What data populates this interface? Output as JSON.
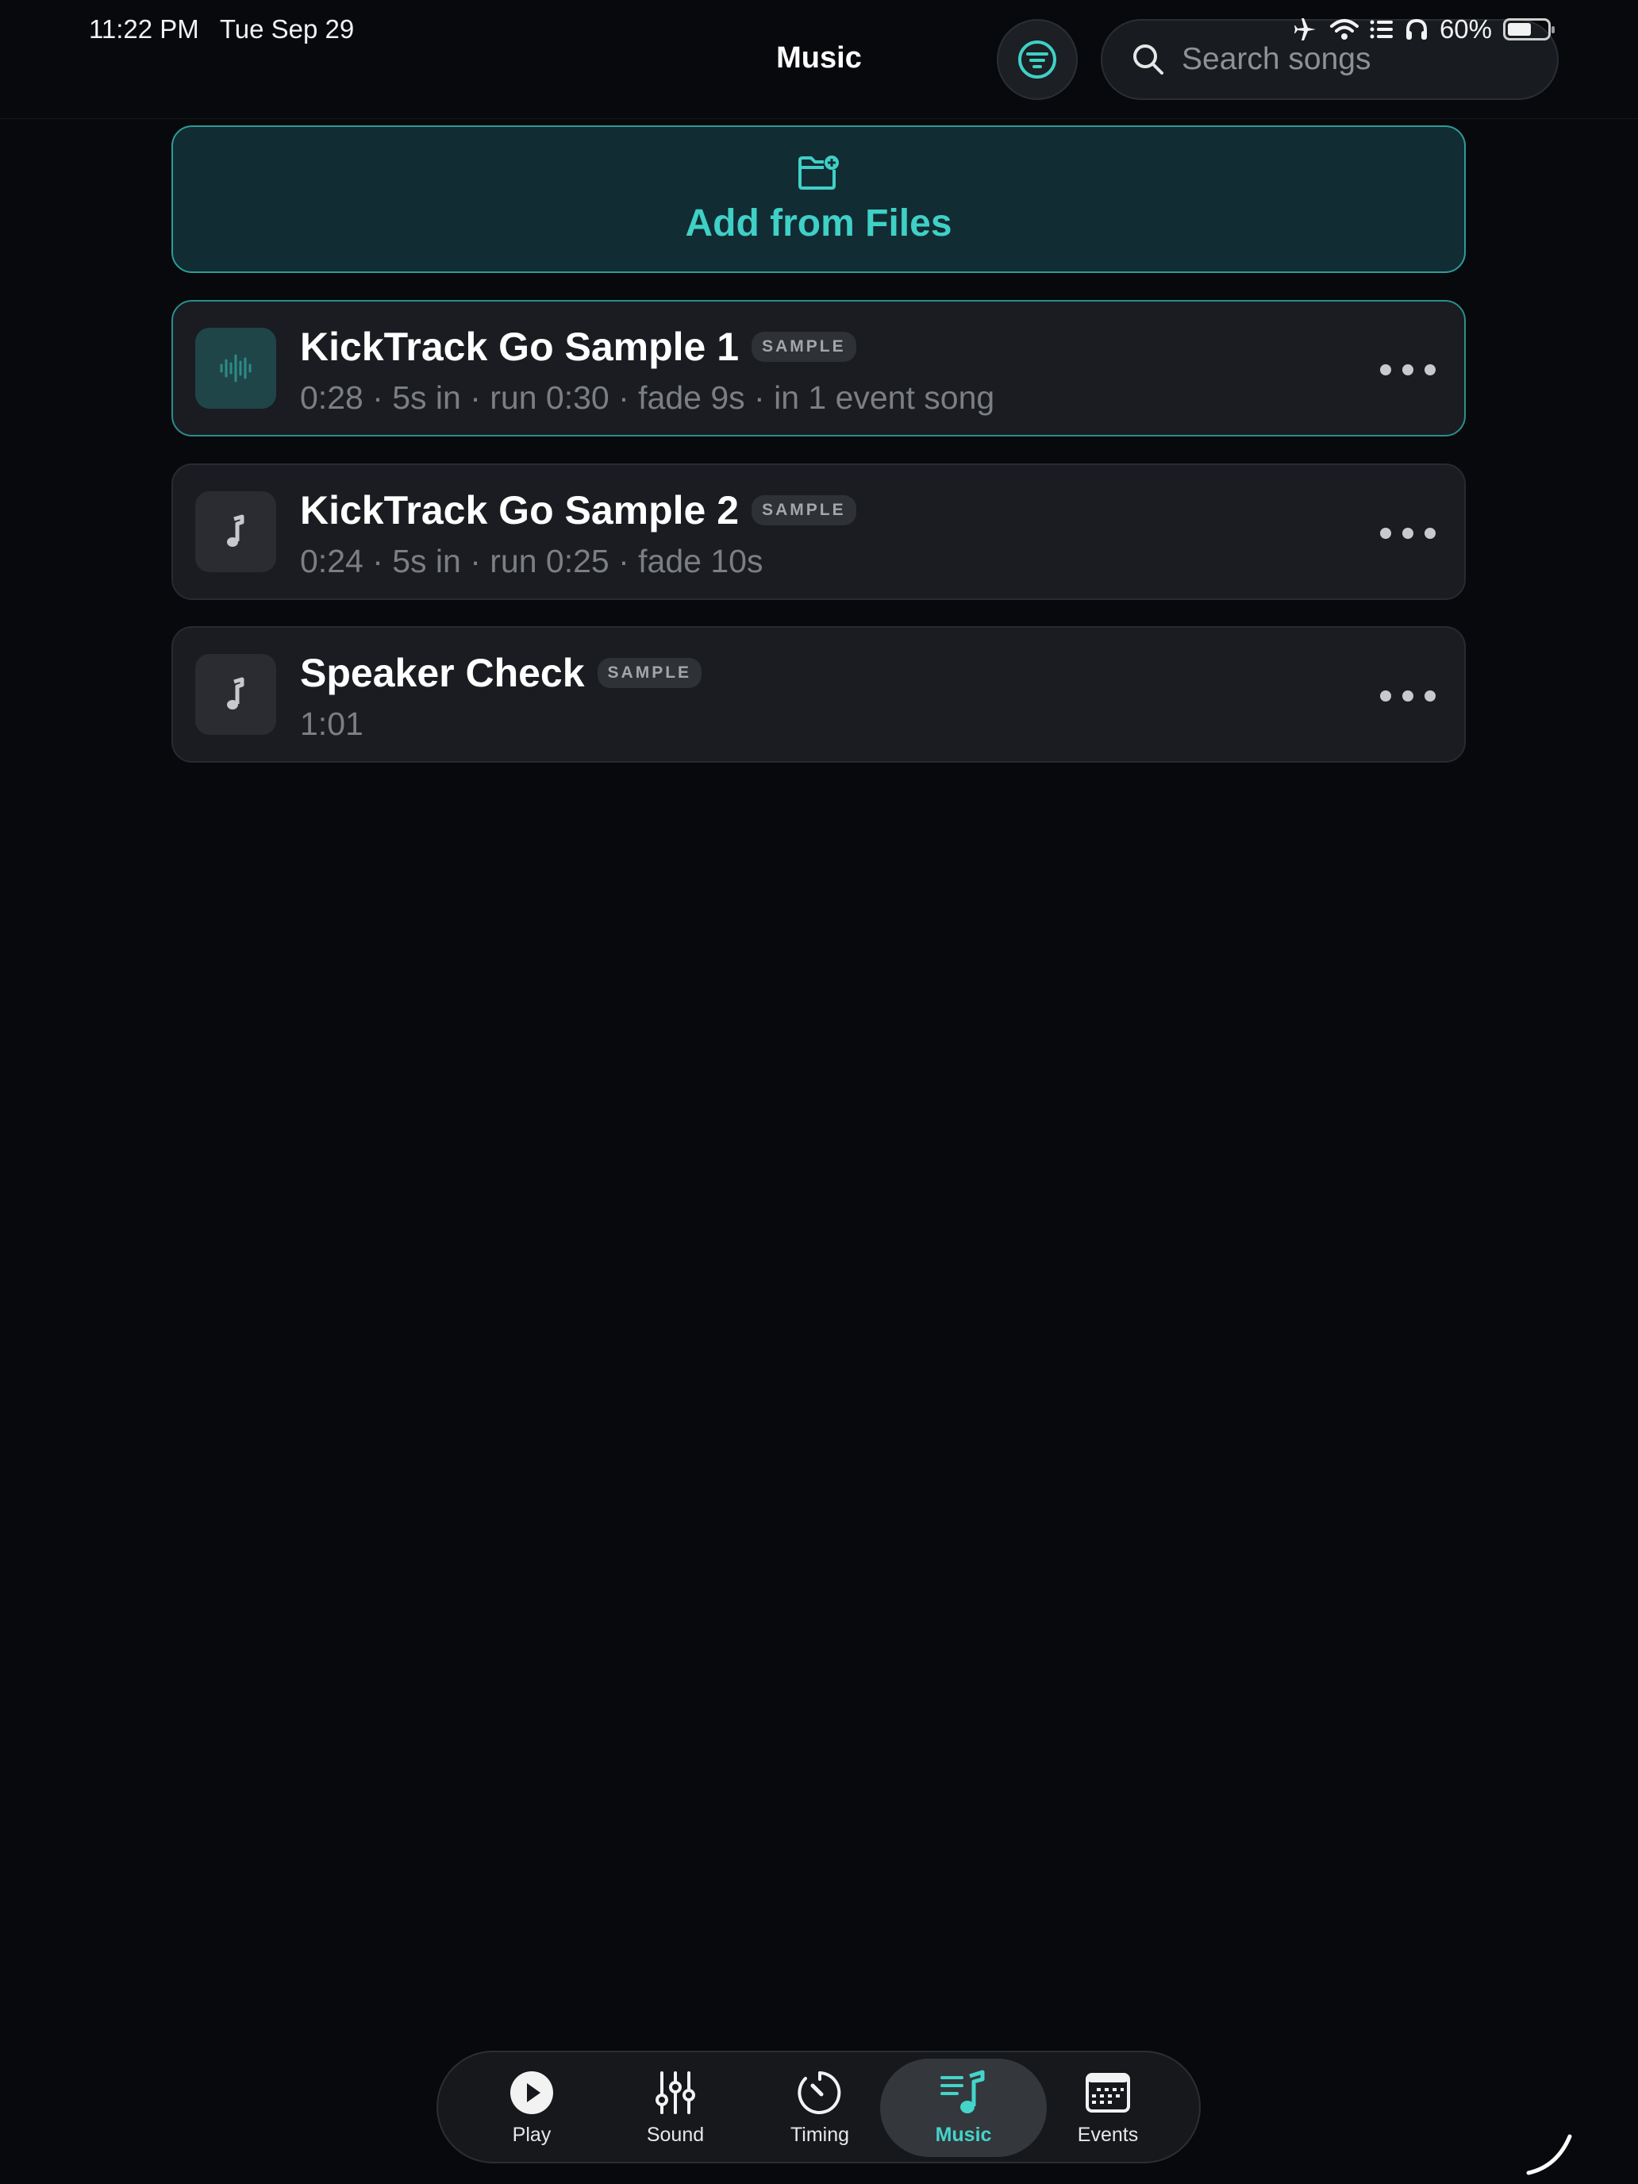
{
  "status_bar": {
    "time": "11:22 PM",
    "date": "Tue Sep 29",
    "battery_percent": "60%",
    "battery_level": 0.6,
    "icons": [
      "airplane-icon",
      "wifi-icon",
      "list-icon",
      "headphones-icon",
      "battery-icon"
    ]
  },
  "nav": {
    "title": "Music",
    "filter_icon": "filter-icon",
    "search_placeholder": "Search songs"
  },
  "add_files": {
    "label": "Add from Files",
    "icon": "folder-add-icon"
  },
  "songs": [
    {
      "title": "KickTrack Go Sample 1",
      "badge": "SAMPLE",
      "meta": "0:28 · 5s in · run 0:30 · fade 9s · in 1 event song",
      "icon": "waveform-icon",
      "active": true
    },
    {
      "title": "KickTrack Go Sample 2",
      "badge": "SAMPLE",
      "meta": "0:24 · 5s in · run 0:25 · fade 10s",
      "icon": "music-note-icon",
      "active": false
    },
    {
      "title": "Speaker Check",
      "badge": "SAMPLE",
      "meta": "1:01",
      "icon": "music-note-icon",
      "active": false
    }
  ],
  "tabs": [
    {
      "label": "Play",
      "icon": "play-icon",
      "selected": false
    },
    {
      "label": "Sound",
      "icon": "sliders-icon",
      "selected": false
    },
    {
      "label": "Timing",
      "icon": "timer-icon",
      "selected": false
    },
    {
      "label": "Music",
      "icon": "music-list-icon",
      "selected": true
    },
    {
      "label": "Events",
      "icon": "calendar-icon",
      "selected": false
    }
  ],
  "colors": {
    "accent": "#3fd0c6",
    "background": "#07090d",
    "card": "#1a1c21",
    "add_files_bg": "#122c33"
  }
}
